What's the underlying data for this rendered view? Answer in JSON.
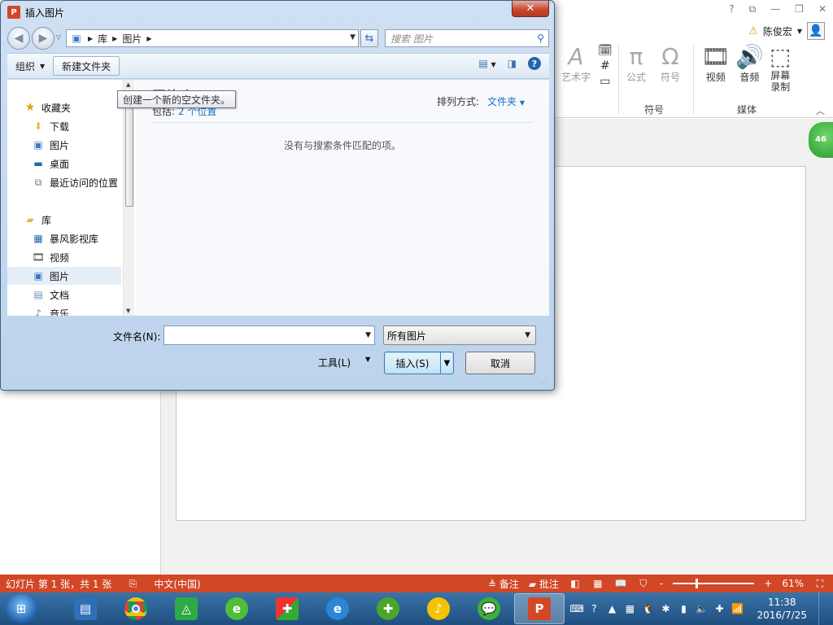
{
  "ppt": {
    "title_controls": [
      "?",
      "⧉",
      "—",
      "❐",
      "✕"
    ],
    "user_name": "陈俊宏",
    "ribbon": {
      "wordart_label": "艺术字",
      "formula_label": "公式",
      "symbol_label": "符号",
      "group_symbols": "符号",
      "video_label": "视频",
      "audio_label": "音频",
      "screen_record_line1": "屏幕",
      "screen_record_line2": "录制",
      "group_media": "媒体"
    },
    "badge": "46"
  },
  "dialog": {
    "title": "插入图片",
    "close_glyph": "✕",
    "breadcrumb": [
      "库",
      "图片"
    ],
    "search_placeholder": "搜索 图片",
    "organize_label": "组织",
    "new_folder_label": "新建文件夹",
    "tooltip": "创建一个新的空文件夹。",
    "nav_items": [
      {
        "label": "收藏夹",
        "icon": "star-icon"
      },
      {
        "label": "下载",
        "icon": "download-folder-icon"
      },
      {
        "label": "图片",
        "icon": "pictures-icon"
      },
      {
        "label": "桌面",
        "icon": "desktop-icon"
      },
      {
        "label": "最近访问的位置",
        "icon": "recent-places-icon"
      },
      {
        "label": "库",
        "icon": "libraries-icon"
      },
      {
        "label": "暴风影视库",
        "icon": "video-library-icon"
      },
      {
        "label": "视频",
        "icon": "videos-icon"
      },
      {
        "label": "图片",
        "icon": "pictures-icon"
      },
      {
        "label": "文档",
        "icon": "documents-icon"
      },
      {
        "label": "音乐",
        "icon": "music-icon"
      }
    ],
    "content": {
      "library_title": "图片库",
      "includes_prefix": "包括:",
      "includes_link": "2 个位置",
      "sort_label": "排列方式:",
      "sort_value": "文件夹",
      "empty_message": "没有与搜索条件匹配的项。"
    },
    "filename_label": "文件名(N):",
    "filename_value": "",
    "filetype_value": "所有图片",
    "tools_label": "工具(L)",
    "insert_label": "插入(S)",
    "cancel_label": "取消"
  },
  "statusbar": {
    "slide_info": "幻灯片 第 1 张，共 1 张",
    "language": "中文(中国)",
    "notes_label": "备注",
    "comments_label": "批注",
    "zoom_minus": "-",
    "zoom_plus": "+",
    "zoom_value": "61%",
    "zoom_level_percent": 61
  },
  "taskbar": {
    "time": "11:38",
    "date": "2016/7/25"
  },
  "colors": {
    "ppt_accent": "#d24726",
    "link_blue": "#1a6fc4",
    "taskbar": "#2a5f94"
  }
}
